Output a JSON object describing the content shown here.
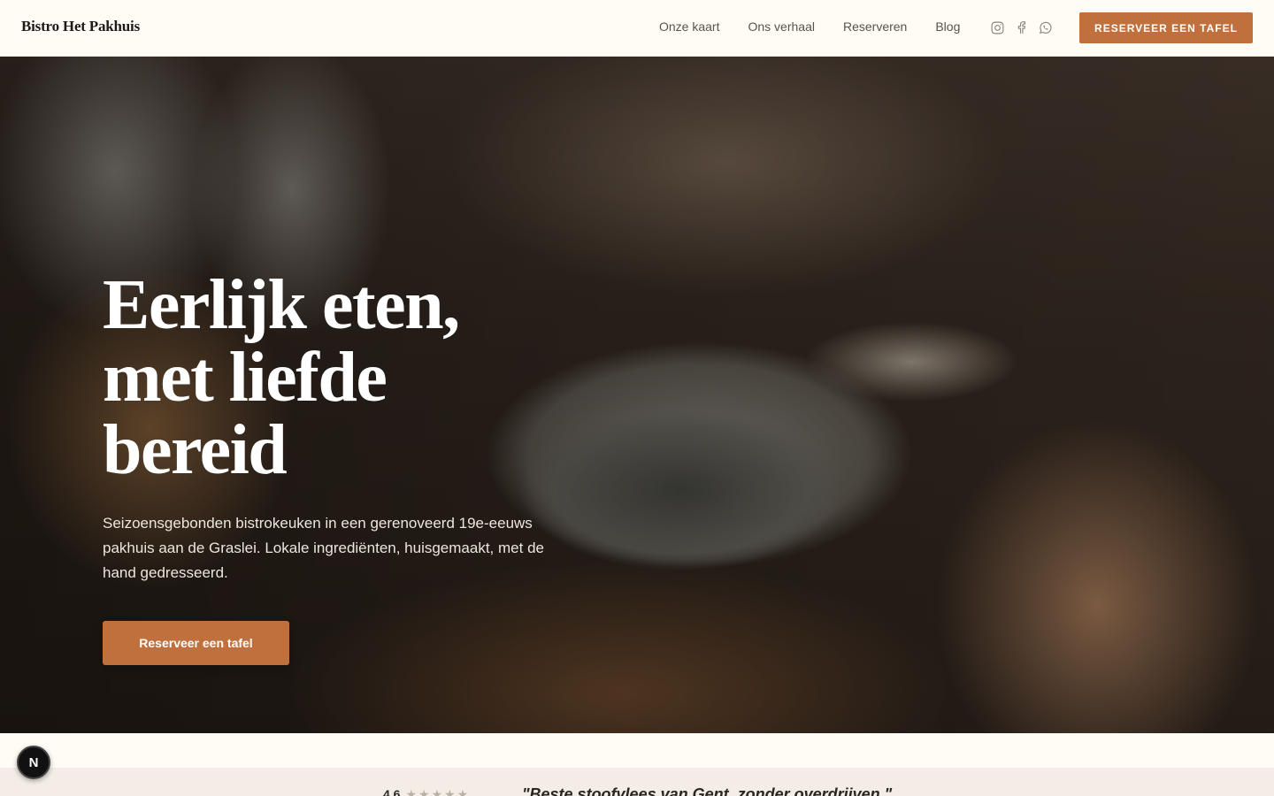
{
  "header": {
    "brand": "Bistro Het Pakhuis",
    "nav": [
      {
        "label": "Onze kaart"
      },
      {
        "label": "Ons verhaal"
      },
      {
        "label": "Reserveren"
      },
      {
        "label": "Blog"
      }
    ],
    "socials": [
      {
        "icon": "instagram-icon"
      },
      {
        "icon": "facebook-icon"
      },
      {
        "icon": "whatsapp-icon"
      }
    ],
    "cta_label": "RESERVEER EEN TAFEL"
  },
  "hero": {
    "title": "Eerlijk eten, met liefde bereid",
    "subtitle": "Seizoensgebonden bistrokeuken in een gerenoveerd 19e-eeuws pakhuis aan de Graslei. Lokale ingrediënten, huisgemaakt, met de hand gedresseerd.",
    "cta_label": "Reserveer een tafel"
  },
  "reviews": {
    "rating": "4.6",
    "quote": "\"Beste stoofvlees van Gent, zonder overdrijven.\""
  },
  "badge": {
    "letter": "N"
  },
  "colors": {
    "accent": "#c0703c",
    "background": "#fffcf6"
  }
}
